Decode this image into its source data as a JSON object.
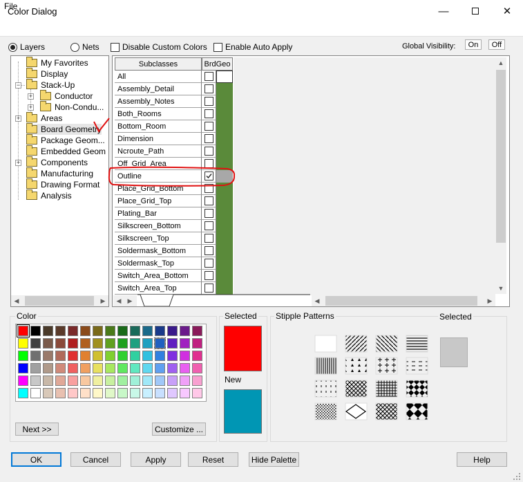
{
  "window": {
    "title": "Color Dialog"
  },
  "menu": {
    "file": "File"
  },
  "options": {
    "layers": "Layers",
    "nets": "Nets",
    "disable_custom_colors": "Disable Custom Colors",
    "enable_auto_apply": "Enable Auto Apply",
    "global_visibility": "Global Visibility:",
    "on": "On",
    "off": "Off"
  },
  "tree": {
    "items": [
      {
        "label": "My Favorites"
      },
      {
        "label": "Display"
      },
      {
        "label": "Stack-Up"
      },
      {
        "label": "Conductor"
      },
      {
        "label": "Non-Condu..."
      },
      {
        "label": "Areas"
      },
      {
        "label": "Board Geometry"
      },
      {
        "label": "Package Geom..."
      },
      {
        "label": "Embedded Geom"
      },
      {
        "label": "Components"
      },
      {
        "label": "Manufacturing"
      },
      {
        "label": "Drawing Format"
      },
      {
        "label": "Analysis"
      }
    ]
  },
  "grid": {
    "col_subclasses": "Subclasses",
    "col_brdgeo": "BrdGeo",
    "rows": [
      {
        "name": "All",
        "checked": false
      },
      {
        "name": "Assembly_Detail",
        "checked": false
      },
      {
        "name": "Assembly_Notes",
        "checked": false
      },
      {
        "name": "Both_Rooms",
        "checked": false
      },
      {
        "name": "Bottom_Room",
        "checked": false
      },
      {
        "name": "Dimension",
        "checked": false
      },
      {
        "name": "Ncroute_Path",
        "checked": false
      },
      {
        "name": "Off_Grid_Area",
        "checked": false
      },
      {
        "name": "Outline",
        "checked": true
      },
      {
        "name": "Place_Grid_Bottom",
        "checked": false
      },
      {
        "name": "Place_Grid_Top",
        "checked": false
      },
      {
        "name": "Plating_Bar",
        "checked": false
      },
      {
        "name": "Silkscreen_Bottom",
        "checked": false
      },
      {
        "name": "Silkscreen_Top",
        "checked": false
      },
      {
        "name": "Soldermask_Bottom",
        "checked": false
      },
      {
        "name": "Soldermask_Top",
        "checked": false
      },
      {
        "name": "Switch_Area_Bottom",
        "checked": false
      },
      {
        "name": "Switch_Area_Top",
        "checked": false
      }
    ]
  },
  "palette": {
    "label": "Color",
    "next": "Next >>",
    "customize": "Customize ...",
    "colors": [
      "#ff0000",
      "#000000",
      "#4a3a2a",
      "#5a3a2a",
      "#7a2a2a",
      "#8a4a1a",
      "#7a6a1a",
      "#4a7a1a",
      "#1a6a1a",
      "#1a6a5a",
      "#1a6a8a",
      "#1a3a8a",
      "#3a1a8a",
      "#6a1a8a",
      "#8a1a5a",
      "#ffff00",
      "#404040",
      "#7a5a4a",
      "#8a4a3a",
      "#b02020",
      "#b06020",
      "#a09020",
      "#60a020",
      "#20a020",
      "#20a080",
      "#20a0c0",
      "#2060c0",
      "#6020c0",
      "#a020c0",
      "#c02080",
      "#00ff00",
      "#707070",
      "#9a7a6a",
      "#b06a5a",
      "#e03030",
      "#e08030",
      "#d0c030",
      "#80d030",
      "#30d030",
      "#30d0a0",
      "#30c0e0",
      "#3080e0",
      "#8030e0",
      "#d030e0",
      "#e03090",
      "#0000ff",
      "#a0a0a0",
      "#b09a8a",
      "#d08a7a",
      "#f06060",
      "#f0a060",
      "#e8e060",
      "#a8e860",
      "#60e860",
      "#60e8c0",
      "#60d8f0",
      "#60a0f0",
      "#a060f0",
      "#e860f0",
      "#f060b0",
      "#ff00ff",
      "#c8c8c8",
      "#c8b8a8",
      "#e0a898",
      "#f8a0a0",
      "#f8c8a0",
      "#f0f0a0",
      "#c8f0a0",
      "#a0f0a0",
      "#a0f0d8",
      "#a0e8f8",
      "#a0c8f8",
      "#c8a0f8",
      "#f0a0f8",
      "#f8a0d0",
      "#00ffff",
      "#ffffff",
      "#d8c8b8",
      "#e8c0b0",
      "#ffc8c8",
      "#ffe0c8",
      "#fff8c8",
      "#e0f8c8",
      "#c8f8c8",
      "#c8f8e8",
      "#c8f0ff",
      "#c8e0ff",
      "#e0c8ff",
      "#f8c8ff",
      "#ffc8e8"
    ]
  },
  "selected": {
    "label": "Selected",
    "new_label": "New",
    "selected_color": "#ff0000",
    "new_color": "#0096b4"
  },
  "stipple": {
    "label": "Stipple Patterns",
    "selected_label": "Selected",
    "selected_color": "#c8c8c8"
  },
  "buttons": {
    "ok": "OK",
    "cancel": "Cancel",
    "apply": "Apply",
    "reset": "Reset",
    "hide_palette": "Hide Palette",
    "help": "Help"
  },
  "annotations": {
    "highlight_color": "#e01010"
  }
}
